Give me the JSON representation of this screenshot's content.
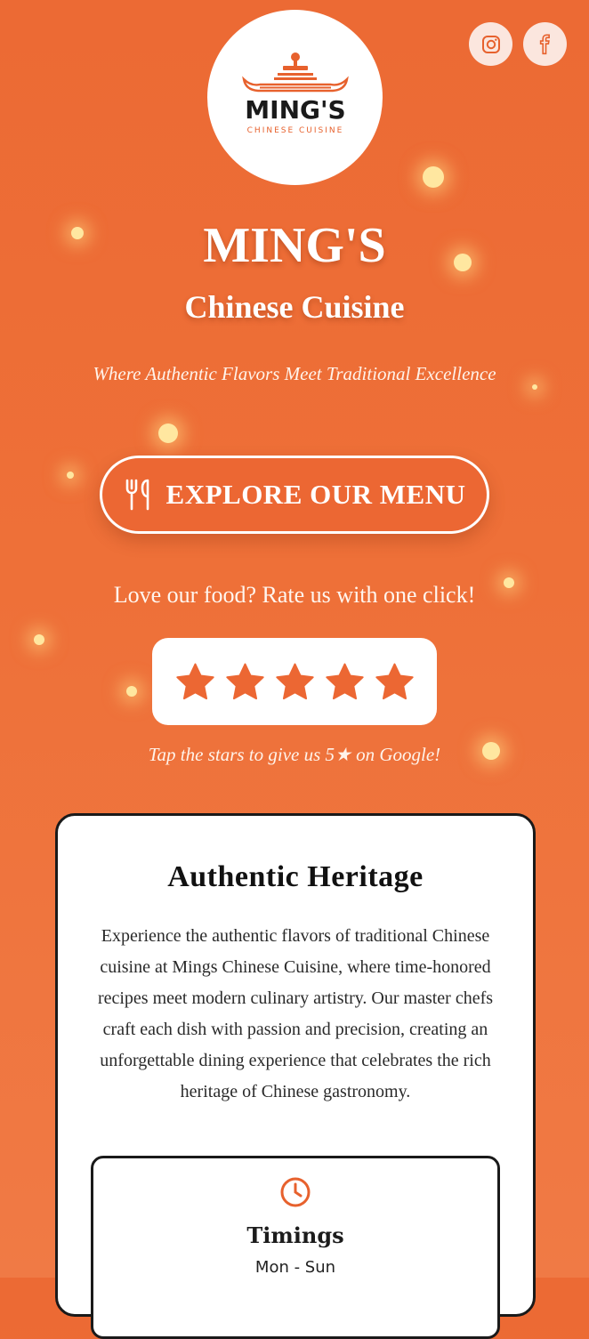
{
  "brand": {
    "logo_name": "MING'S",
    "logo_sub": "CHINESE CUISINE",
    "title": "MING'S",
    "subtitle": "Chinese Cuisine",
    "tagline": "Where Authentic Flavors Meet Traditional Excellence"
  },
  "social": {
    "instagram_icon": "instagram-icon",
    "facebook_icon": "facebook-icon"
  },
  "menu_button": {
    "label": "EXPLORE OUR MENU",
    "icon": "utensils-icon"
  },
  "rating": {
    "prompt": "Love our food? Rate us with one click!",
    "stars": 5,
    "hint": "Tap the stars to give us 5★ on Google!"
  },
  "heritage": {
    "heading": "Authentic Heritage",
    "body": "Experience the authentic flavors of traditional Chinese cuisine at Mings Chinese Cuisine, where time-honored recipes meet modern culinary artistry. Our master chefs craft each dish with passion and precision, creating an unforgettable dining experience that celebrates the rich heritage of Chinese gastronomy."
  },
  "timings": {
    "heading": "Timings",
    "days": "Mon - Sun",
    "icon": "clock-icon"
  },
  "colors": {
    "accent": "#ec6733",
    "background": "#ee7038",
    "card": "#ffffff"
  }
}
